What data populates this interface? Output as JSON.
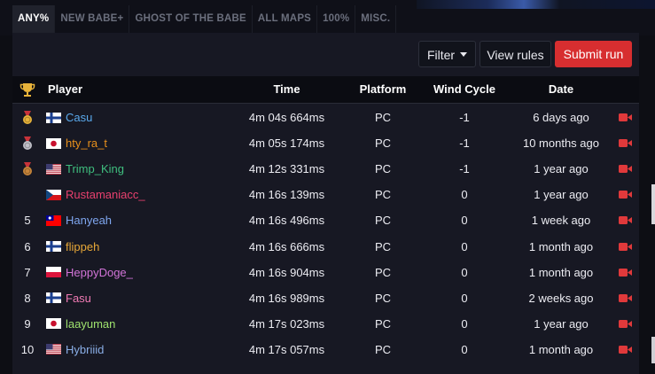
{
  "tabs": [
    "ANY%",
    "NEW BABE+",
    "GHOST OF THE BABE",
    "ALL MAPS",
    "100%",
    "MISC."
  ],
  "toolbar": {
    "filter_label": "Filter",
    "rules_label": "View rules",
    "submit_label": "Submit run"
  },
  "columns": {
    "player": "Player",
    "time": "Time",
    "platform": "Platform",
    "wind": "Wind Cycle",
    "date": "Date"
  },
  "colors": {
    "accent_red": "#d72e30",
    "video_icon": "#e0393b",
    "gold": "#e8b33a",
    "silver": "#c0c0c8",
    "bronze": "#c7853a"
  },
  "rows": [
    {
      "rank": "",
      "medal": "gold",
      "flag": "finland",
      "player": "Casu",
      "color": "#5aa9ec",
      "time": "4m 04s 664ms",
      "platform": "PC",
      "wind": "-1",
      "date": "6 days ago"
    },
    {
      "rank": "",
      "medal": "silver",
      "flag": "japan",
      "player": "hty_ra_t",
      "color": "#e8901c",
      "time": "4m 05s 174ms",
      "platform": "PC",
      "wind": "-1",
      "date": "10 months ago"
    },
    {
      "rank": "",
      "medal": "bronze",
      "flag": "usa",
      "player": "Trimp_King",
      "color": "#3fbf7f",
      "time": "4m 12s 331ms",
      "platform": "PC",
      "wind": "-1",
      "date": "1 year ago"
    },
    {
      "rank": "",
      "medal": "",
      "flag": "czech",
      "player": "Rustamaniacc_",
      "color": "#e8406e",
      "time": "4m 16s 139ms",
      "platform": "PC",
      "wind": "0",
      "date": "1 year ago"
    },
    {
      "rank": "5",
      "medal": "",
      "flag": "taiwan",
      "player": "Hanyeah",
      "color": "#7fa6ef",
      "time": "4m 16s 496ms",
      "platform": "PC",
      "wind": "0",
      "date": "1 week ago"
    },
    {
      "rank": "6",
      "medal": "",
      "flag": "finland",
      "player": "flippeh",
      "color": "#e8a838",
      "time": "4m 16s 666ms",
      "platform": "PC",
      "wind": "0",
      "date": "1 month ago"
    },
    {
      "rank": "7",
      "medal": "",
      "flag": "poland",
      "player": "HeppyDoge_",
      "color": "#d274d8",
      "time": "4m 16s 904ms",
      "platform": "PC",
      "wind": "0",
      "date": "1 month ago"
    },
    {
      "rank": "8",
      "medal": "",
      "flag": "finland",
      "player": "Fasu",
      "color": "#f07ab4",
      "time": "4m 16s 989ms",
      "platform": "PC",
      "wind": "0",
      "date": "2 weeks ago"
    },
    {
      "rank": "9",
      "medal": "",
      "flag": "japan",
      "player": "laayuman",
      "color": "#9fe26e",
      "time": "4m 17s 023ms",
      "platform": "PC",
      "wind": "0",
      "date": "1 year ago"
    },
    {
      "rank": "10",
      "medal": "",
      "flag": "usa",
      "player": "Hybriiid",
      "color": "#8aaee6",
      "time": "4m 17s 057ms",
      "platform": "PC",
      "wind": "0",
      "date": "1 month ago"
    }
  ]
}
